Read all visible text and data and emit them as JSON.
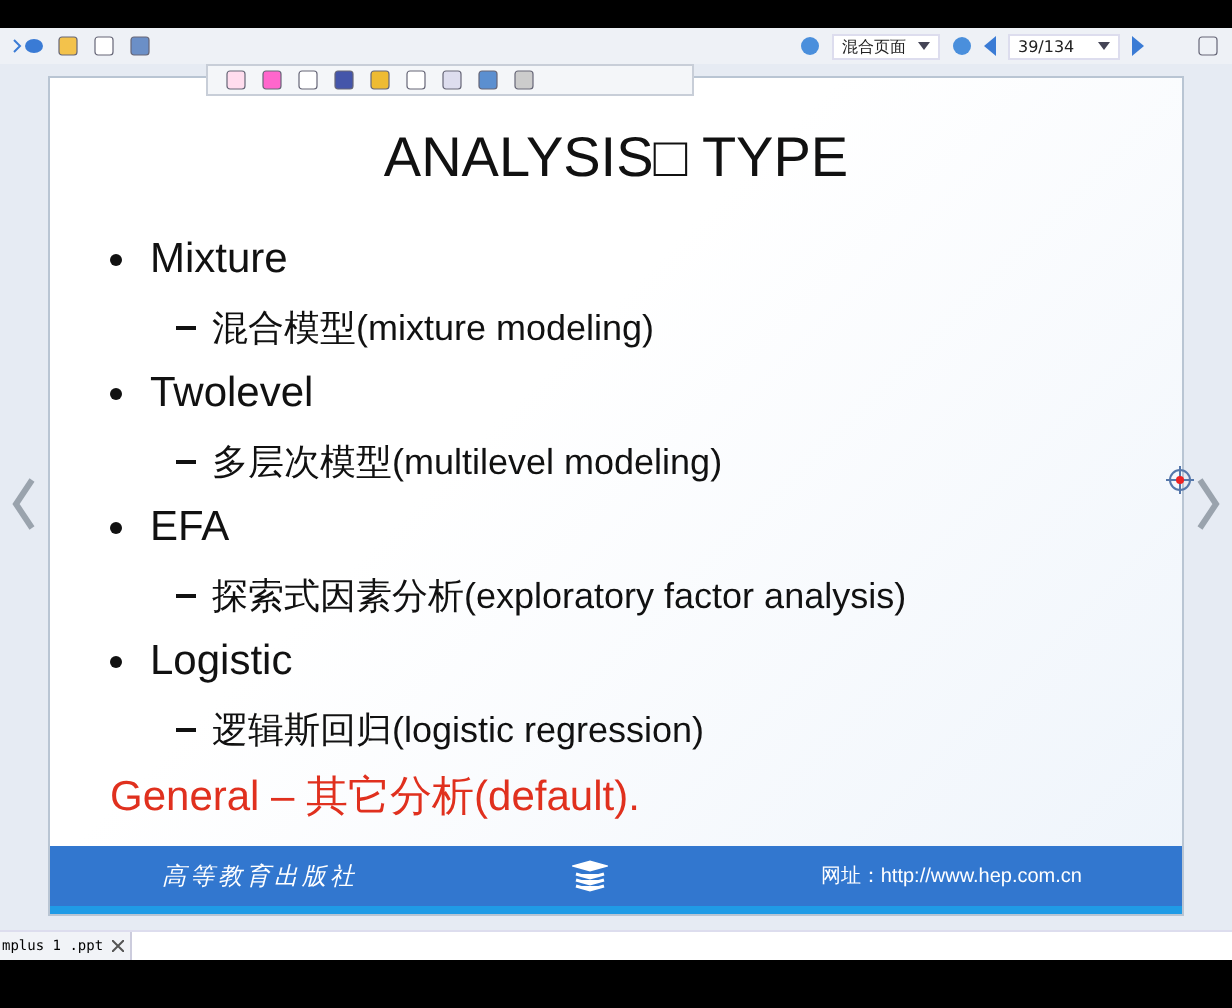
{
  "toolbar": {
    "view_mode": "混合页面",
    "page": "39/134"
  },
  "slide": {
    "title": "ANALYSIS□  TYPE",
    "items": [
      {
        "label": "Mixture",
        "highlighted": false,
        "children": [
          {
            "label": "混合模型(mixture modeling)"
          }
        ]
      },
      {
        "label": "Twolevel",
        "highlighted": false,
        "children": [
          {
            "label": "多层次模型(multilevel modeling)"
          }
        ]
      },
      {
        "label": "EFA",
        "highlighted": false,
        "children": [
          {
            "label": "探索式因素分析(exploratory factor analysis)"
          }
        ]
      },
      {
        "label": "Logistic",
        "highlighted": false,
        "children": [
          {
            "label": "逻辑斯回归(logistic regression)"
          }
        ]
      },
      {
        "label": "General – 其它分析(default).",
        "highlighted": true
      }
    ],
    "footer": {
      "publisher": "高等教育出版社",
      "website": "网址：http://www.hep.com.cn"
    }
  },
  "tabs": [
    {
      "label": "mplus 1 .ppt",
      "selected": true
    }
  ]
}
